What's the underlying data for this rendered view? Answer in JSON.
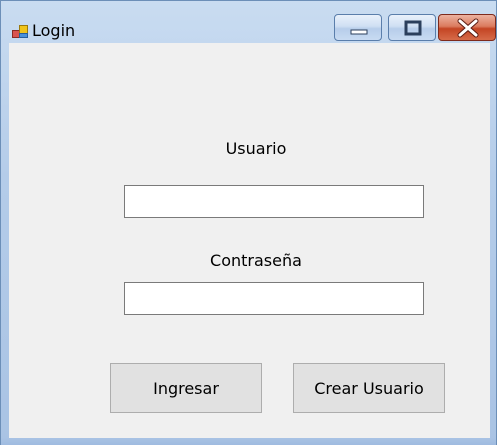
{
  "window": {
    "title": "Login",
    "icons": {
      "app": "windows-form-icon",
      "minimize": "minimize-icon",
      "maximize": "maximize-icon",
      "close": "close-icon"
    }
  },
  "form": {
    "user_label": "Usuario",
    "user_value": "",
    "password_label": "Contraseña",
    "password_value": "",
    "login_button": "Ingresar",
    "create_user_button": "Crear Usuario"
  },
  "colors": {
    "client_background": "#f0f0f0",
    "button_face": "#e1e1e1",
    "close_button": "#c44524"
  }
}
